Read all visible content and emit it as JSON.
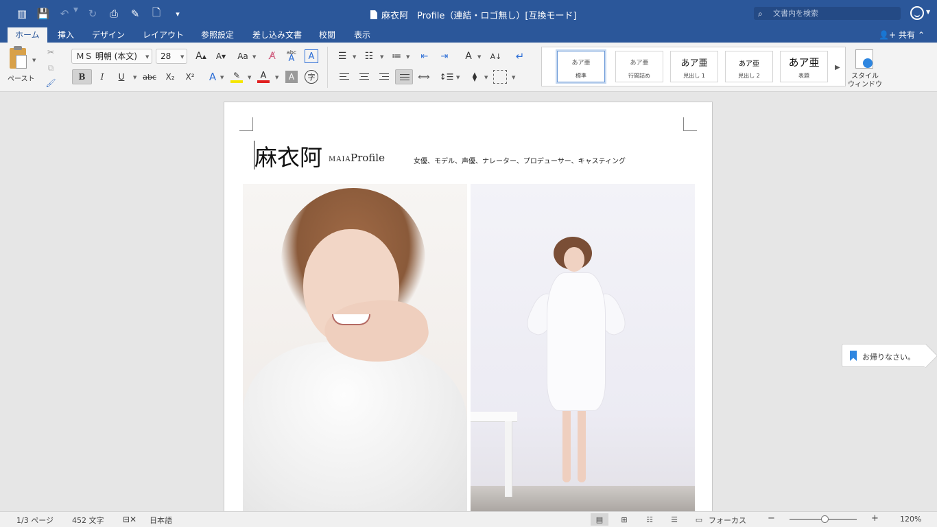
{
  "window": {
    "title": "麻衣阿　Profile（連結・ロゴ無し）[互換モード]",
    "search_placeholder": "文書内を検索"
  },
  "quick_access": {
    "icons": [
      "sidebar-icon",
      "save-icon",
      "undo-icon",
      "redo-icon",
      "print-icon",
      "edit-icon",
      "new-document-icon",
      "customize-icon"
    ]
  },
  "tabs": [
    "ホーム",
    "挿入",
    "デザイン",
    "レイアウト",
    "参照設定",
    "差し込み文書",
    "校閲",
    "表示"
  ],
  "active_tab": "ホーム",
  "share_label": "共有",
  "ribbon": {
    "paste_label": "ペースト",
    "font_name": "ＭＳ 明朝 (本文)",
    "font_size": "28",
    "bold": "B",
    "italic": "I",
    "underline": "U",
    "strikethrough": "abc",
    "subscript": "X₂",
    "superscript": "X²",
    "glyph_abc": "abc",
    "glyph_A": "A",
    "glyph_Aa": "Aa",
    "glyph_ji": "字",
    "styles": [
      {
        "sample": "あア亜",
        "name": "標準",
        "selected": true
      },
      {
        "sample": "あア亜",
        "name": "行間詰め",
        "selected": false
      },
      {
        "sample": "あア亜",
        "name": "見出し 1",
        "selected": false
      },
      {
        "sample": "あア亜",
        "name": "見出し 2",
        "selected": false
      },
      {
        "sample": "あア亜",
        "name": "表題",
        "selected": false
      }
    ],
    "style_window_label_1": "スタイル",
    "style_window_label_2": "ウィンドウ",
    "highlight_color": "#f5e600",
    "font_color": "#e02020"
  },
  "document": {
    "heading": "麻衣阿",
    "sub_small": "MAIA",
    "sub": "Profile",
    "tags": "女優、モデル、声優、ナレーター、プロデューサー、キャスティング"
  },
  "notification": {
    "text": "お帰りなさい。"
  },
  "status": {
    "page": "1/3 ページ",
    "words": "452 文字",
    "language": "日本語",
    "focus_label": "フォーカス",
    "zoom": "120%",
    "zoom_slider_fraction": 0.52,
    "zoom_minus": "−",
    "zoom_plus": "+"
  }
}
